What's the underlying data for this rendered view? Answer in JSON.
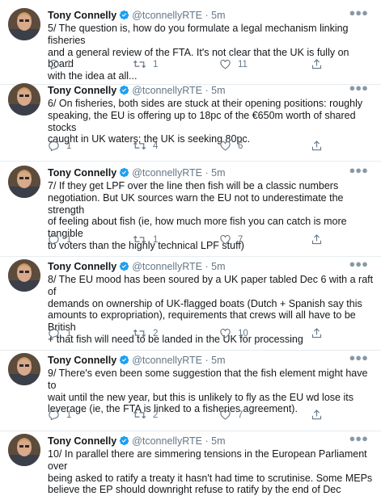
{
  "author": {
    "name": "Tony Connelly",
    "handle": "@tconnellyRTE",
    "separator": "·"
  },
  "colors": {
    "text": "#14171a",
    "secondary": "#657786",
    "verified": "#1da1f2",
    "divider": "#e6ecf0"
  },
  "icons": [
    "reply-icon",
    "retweet-icon",
    "like-icon",
    "share-icon",
    "more-icon",
    "verified-badge-icon"
  ],
  "tweets": [
    {
      "time": "5m",
      "lines": [
        "5/ The question is, how do you formulate a legal mechanism linking fisheries",
        "and a general review of the FTA. It's not clear that the UK is fully on board",
        "with the idea at all..."
      ],
      "replies": "1",
      "retweets": "1",
      "likes": "11"
    },
    {
      "time": "5m",
      "lines": [
        "6/ On fisheries, both sides are stuck at their opening positions: roughly",
        "speaking, the EU is offering up to 18pc of the €650m worth of shared stocks",
        "caught in UK waters; the UK is seeking 80pc."
      ],
      "replies": "1",
      "retweets": "4",
      "likes": "6"
    },
    {
      "time": "5m",
      "lines": [
        "7/ If they get LPF over the line then fish will be a classic numbers",
        "negotiation. But UK sources warn the EU not to underestimate the strength",
        "of feeling about fish (ie, how much more fish you can catch is more tangible",
        "to voters than the highly technical LPF stuff)"
      ],
      "replies": "1",
      "retweets": "1",
      "likes": "7"
    },
    {
      "time": "5m",
      "lines": [
        "8/ The EU mood has been soured by a UK paper tabled Dec 6 with a raft of",
        "demands on ownership of UK-flagged boats (Dutch + Spanish say this",
        "amounts to expropriation), requirements that crews will all have to be British",
        "+ that fish will need to be landed in the UK for processing"
      ],
      "replies": "1",
      "retweets": "2",
      "likes": "10"
    },
    {
      "time": "5m",
      "lines": [
        "9/ There's even been some suggestion that the fish element might have to",
        "wait until the new year, but this is unlikely to fly as the EU wd lose its",
        "leverage (ie, the FTA is linked to a fisheries agreement)."
      ],
      "replies": "1",
      "retweets": "2",
      "likes": "7"
    },
    {
      "time": "5m",
      "lines": [
        "10/ In parallel there are simmering tensions in the European Parliament over",
        "being asked to ratify a treaty it hasn't had time to scrutinise. Some MEPs",
        "believe the EP should downright refuse to ratify by the end of Dec"
      ],
      "replies": "",
      "retweets": "",
      "likes": ""
    }
  ]
}
